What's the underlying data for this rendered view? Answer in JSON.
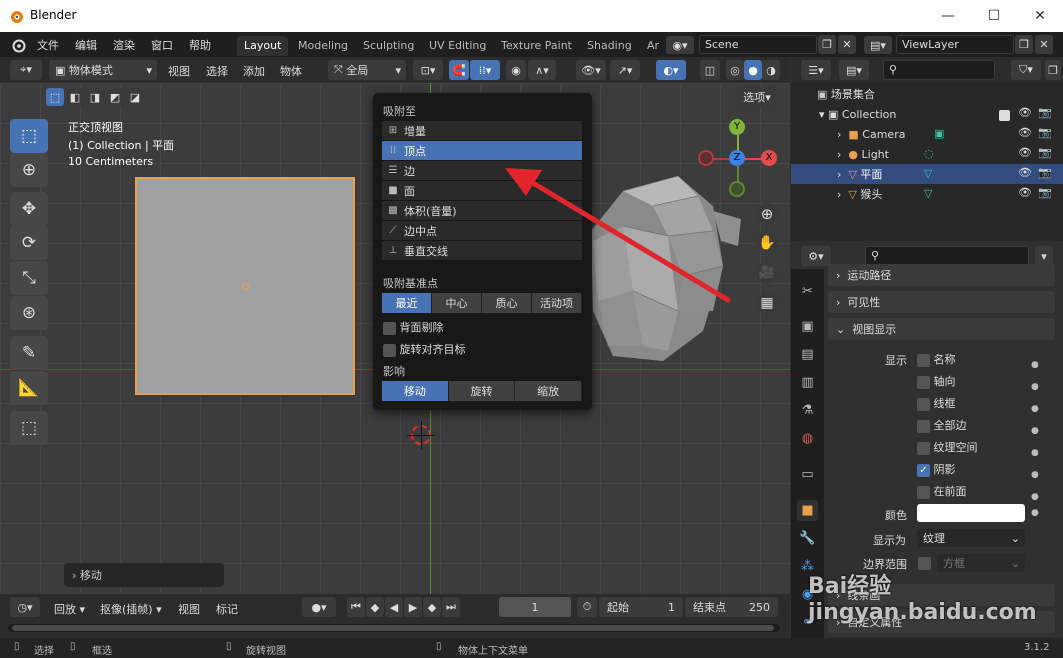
{
  "titlebar": {
    "app_title": "Blender",
    "minimize": "—",
    "maximize": "☐",
    "close": "✕"
  },
  "menu": {
    "items": [
      "文件",
      "编辑",
      "渲染",
      "窗口",
      "帮助"
    ],
    "tabs": [
      "Layout",
      "Modeling",
      "Sculpting",
      "UV Editing",
      "Texture Paint",
      "Shading",
      "Ar"
    ],
    "active_tab": "Layout",
    "scene": "Scene",
    "view_layer": "ViewLayer"
  },
  "viewport_header": {
    "mode": "物体模式",
    "menus": [
      "视图",
      "选择",
      "添加",
      "物体"
    ],
    "transform_orientation": "全局",
    "options": "选项"
  },
  "viewport": {
    "view_name": "正交顶视图",
    "collection_info": "(1) Collection | 平面",
    "scale": "10 Centimeters",
    "last_operator": "移动",
    "gizmo": {
      "y": "Y",
      "x": "X",
      "z": "Z"
    }
  },
  "snap_popup": {
    "snap_to_label": "吸附至",
    "snap_to": [
      {
        "icon": "increment-icon",
        "label": "增量"
      },
      {
        "icon": "vertex-icon",
        "label": "顶点"
      },
      {
        "icon": "edge-icon",
        "label": "边"
      },
      {
        "icon": "face-icon",
        "label": "面"
      },
      {
        "icon": "volume-icon",
        "label": "体积(音量)"
      },
      {
        "icon": "edge-center-icon",
        "label": "边中点"
      },
      {
        "icon": "perpendicular-icon",
        "label": "垂直交线"
      }
    ],
    "selected_index": 1,
    "snap_base_label": "吸附基准点",
    "snap_base": [
      "最近",
      "中心",
      "质心",
      "活动项"
    ],
    "snap_base_active": 0,
    "backface": "背面剔除",
    "align_rotation": "旋转对齐目标",
    "affect_label": "影响",
    "affect": [
      "移动",
      "旋转",
      "缩放"
    ],
    "affect_active": 0
  },
  "outliner": {
    "root": "场景集合",
    "collection": "Collection",
    "objects": [
      {
        "name": "Camera",
        "icon": "camera-icon",
        "color": "#e8a04a",
        "selected": false
      },
      {
        "name": "Light",
        "icon": "light-icon",
        "color": "#e8a04a",
        "selected": false
      },
      {
        "name": "平面",
        "icon": "mesh-icon",
        "color": "#e8a04a",
        "selected": true
      },
      {
        "name": "猴头",
        "icon": "mesh-icon",
        "color": "#e8a04a",
        "selected": false
      }
    ]
  },
  "properties": {
    "sections": [
      "运动路径",
      "可见性",
      "视图显示"
    ],
    "display_label": "显示",
    "display_options": [
      {
        "label": "名称",
        "checked": false
      },
      {
        "label": "轴向",
        "checked": false
      },
      {
        "label": "线框",
        "checked": false
      },
      {
        "label": "全部边",
        "checked": false
      },
      {
        "label": "纹理空间",
        "checked": false
      },
      {
        "label": "阴影",
        "checked": true
      },
      {
        "label": "在前面",
        "checked": false
      }
    ],
    "color_label": "颜色",
    "display_as_label": "显示为",
    "display_as_value": "纹理",
    "bounds_label": "边界范围",
    "bounds_value": "方框",
    "section_bottom_1": "线条画",
    "section_bottom_2": "自定义属性"
  },
  "timeline": {
    "playback": "回放",
    "keying": "抠像(插帧)",
    "view": "视图",
    "marker": "标记",
    "current_frame": "1",
    "start_label": "起始",
    "start_value": "1",
    "end_label": "结束点",
    "end_value": "250"
  },
  "statusbar": {
    "select": "选择",
    "box_select": "框选",
    "rotate_view": "旋转视图",
    "context_menu": "物体上下文菜单",
    "version": "3.1.2"
  },
  "watermark": "Bai经验 jingyan.baidu.com",
  "colors": {
    "accent": "#4772b3",
    "selection_orange": "#e8a04a",
    "arrow": "#e0262a"
  }
}
